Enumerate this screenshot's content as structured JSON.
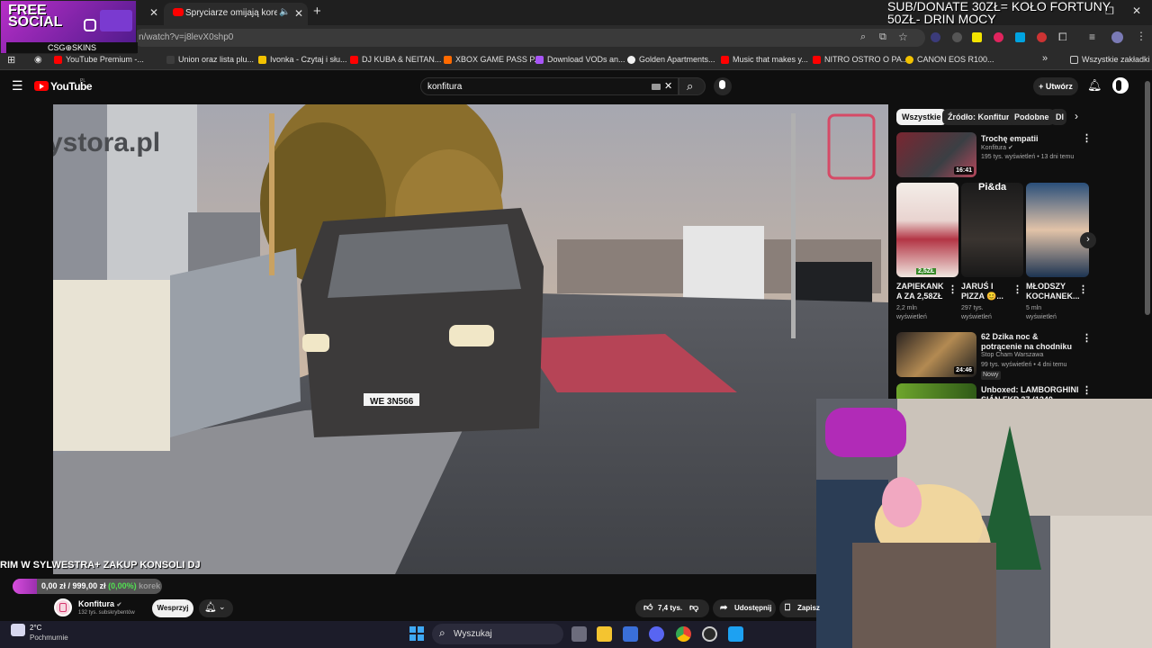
{
  "browser": {
    "active_tab_title": "Spryciarze omijają korek - YouTube",
    "url": "n/watch?v=j8levX0shp0",
    "bookmarks": [
      {
        "label": "YouTube Premium -...",
        "color": "#ff0000"
      },
      {
        "label": "Union oraz lista plu...",
        "color": "#3d3d3d"
      },
      {
        "label": "Ivonka - Czytaj i słu...",
        "color": "#f2c200"
      },
      {
        "label": "DJ KUBA & NEITAN...",
        "color": "#ff0000"
      },
      {
        "label": "XBOX GAME PASS P...",
        "color": "#ff6a00"
      },
      {
        "label": "Download VODs an...",
        "color": "#a855f7"
      },
      {
        "label": "Golden Apartments...",
        "color": "#f1f1f1"
      },
      {
        "label": "Music that makes y...",
        "color": "#ff0000"
      },
      {
        "label": "NITRO OSTRO O PA...",
        "color": "#ff0000"
      },
      {
        "label": "CANON EOS R100...",
        "color": "#f2c200"
      }
    ],
    "all_bookmarks_label": "Wszystkie zakładki"
  },
  "overlay": {
    "free_social_line1": "FREE",
    "free_social_line2": "SOCIAL",
    "csg_skins": "CSG⊕SKINS",
    "donate_line1": "SUB/DONATE 30ZŁ= KOŁO FORTUNY",
    "donate_line2": "50ZŁ- DRIN MOCY",
    "ticker": "RIM W SYLWESTRA+ ZAKUP KONSOLI DJ",
    "goal_current": "0,00 zł",
    "goal_target": "999,00 zł",
    "goal_percent_text": "(0,00%)",
    "goal_fraction": 0.0,
    "goal_ghost_text": "korek"
  },
  "youtube": {
    "logo_text": "YouTube",
    "logo_region": "PL",
    "search_query": "konfitura",
    "create_label": "Utwórz",
    "chips": [
      "Wszystkie",
      "Źródło: Konfitura",
      "Podobne",
      "Dl"
    ],
    "video": {
      "plate": "WE 3N566",
      "watermark": "ystora.pl"
    },
    "channel": {
      "name": "Konfitura",
      "subscribers": "132 tys. subskrybentów",
      "support_label": "Wesprzyj"
    },
    "actions": {
      "likes": "7,4 tys.",
      "share": "Udostępnij",
      "save": "Zapisz"
    },
    "recommendations": [
      {
        "title": "Trochę empatii",
        "channel": "Konfitura",
        "meta": "195 tys. wyświetleń • 13 dni temu",
        "duration": "16:41"
      },
      {
        "title": "62 Dzika noc & potrącenie na chodniku",
        "channel": "Stop Cham Warszawa",
        "meta": "99 tys. wyświetleń • 4 dni temu",
        "badge": "Nowy",
        "duration": "24:46"
      },
      {
        "title": "Unboxed: LAMBORGHINI SIÁN FKP 37 (1240 pieces) Mould",
        "channel": "",
        "meta": "",
        "duration": ""
      }
    ],
    "shorts": [
      {
        "title": "ZAPIEKANK A ZA 2,58ZŁ",
        "views": "2,2 mln wyświetleń",
        "badge": "2,5ZŁ"
      },
      {
        "title": "JARUŚ I PIZZA 😊...",
        "views": "297 tys. wyświetleń",
        "badge": "Pi&da"
      },
      {
        "title": "MŁODSZY KOCHANEK...",
        "views": "5 mln wyświetleń",
        "badge": ""
      }
    ]
  },
  "taskbar": {
    "weather_temp": "2°C",
    "weather_desc": "Pochmurnie",
    "search_placeholder": "Wyszukaj"
  }
}
